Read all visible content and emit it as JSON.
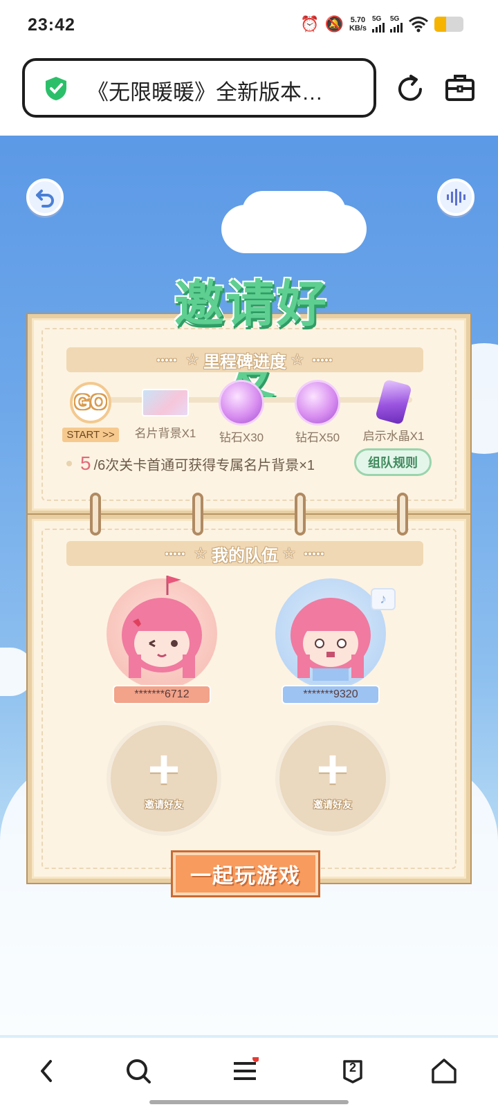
{
  "status_bar": {
    "time": "23:42",
    "net_speed_value": "5.70",
    "net_speed_unit": "KB/s",
    "sim1": "5G",
    "sim2": "5G",
    "battery_level": 0.4,
    "icons": [
      "alarm-icon",
      "mute-icon",
      "signal-icon",
      "wifi-icon",
      "battery-icon"
    ]
  },
  "browser": {
    "url_title": "《无限暖暖》全新版本…",
    "secure_icon": "shield-check-icon",
    "reload_icon": "reload-icon",
    "toolbox_icon": "toolbox-icon"
  },
  "game": {
    "title": "邀请好友",
    "milestone_section": {
      "header": "里程碑进度",
      "milestones": [
        {
          "node": "GO",
          "label": "START >>"
        },
        {
          "label": "名片背景X1",
          "icon": "card-background-icon"
        },
        {
          "label": "钻石X30",
          "icon": "diamond-icon"
        },
        {
          "label": "钻石X50",
          "icon": "diamond-icon"
        },
        {
          "label": "启示水晶X1",
          "icon": "crystal-icon"
        }
      ],
      "progress_current": "5",
      "progress_text": "/6次关卡首通可获得专属名片背景×1",
      "rule_button": "组队规则"
    },
    "team_section": {
      "header": "我的队伍",
      "members": [
        {
          "name": "*******6712",
          "theme": "#f2a38a",
          "badge_icon": "flag-icon"
        },
        {
          "name": "*******9320",
          "theme": "#9cc3f2",
          "badge_icon": "music-note-icon"
        }
      ],
      "empty_slots": [
        {
          "label": "邀请好友"
        },
        {
          "label": "邀请好友"
        }
      ]
    },
    "play_button": "一起玩游戏"
  },
  "bottom_nav": {
    "tab_count": "2",
    "items": [
      "back-icon",
      "search-icon",
      "menu-icon",
      "tabs-icon",
      "home-icon"
    ]
  },
  "colors": {
    "title_green": "#5fcf91",
    "accent_orange": "#f79b5e",
    "progress_pink": "#e26a7a",
    "sky_blue": "#5c99e6"
  }
}
